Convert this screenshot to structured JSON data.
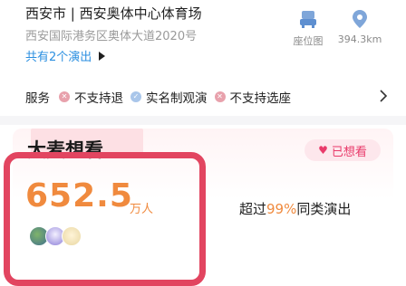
{
  "venue": {
    "title": "西安市 | 西安奥体中心体育场",
    "address": "西安国际港务区奥体大道2020号",
    "shows_link": "共有2个演出"
  },
  "quick_actions": {
    "seat_map_label": "座位图",
    "distance_label": "394.3km"
  },
  "service": {
    "label": "服务",
    "items": [
      {
        "label": "不支持退",
        "status": "no"
      },
      {
        "label": "实名制观演",
        "status": "yes"
      },
      {
        "label": "不支持选座",
        "status": "no"
      }
    ]
  },
  "want_card": {
    "title": "大麦想看",
    "badge_label": "已想看",
    "count_value": "652.5",
    "count_unit": "万人",
    "compare_prefix": "超过",
    "compare_percent": "99%",
    "compare_suffix": "同类演出"
  },
  "colors": {
    "accent_orange": "#f08a3e",
    "link_blue": "#2b8fe0",
    "highlight_red": "#e24560",
    "badge_pink": "#e93a6a"
  }
}
